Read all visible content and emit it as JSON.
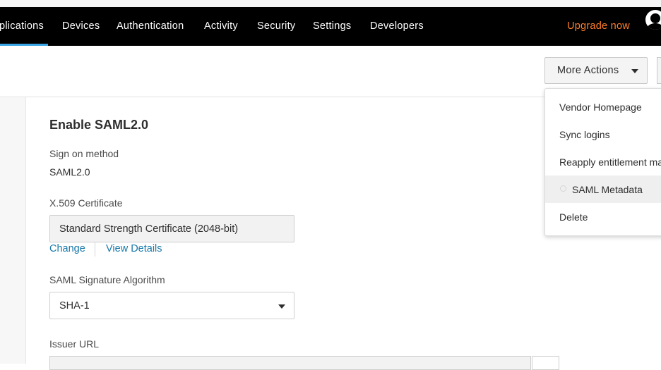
{
  "nav": {
    "items": [
      "plications",
      "Devices",
      "Authentication",
      "Activity",
      "Security",
      "Settings",
      "Developers"
    ],
    "upgrade": "Upgrade now",
    "active_color": "#3aa5e6",
    "upgrade_color": "#ff7e29"
  },
  "toolbar": {
    "more_actions": "More Actions"
  },
  "menu": {
    "items": [
      "Vendor Homepage",
      "Sync logins",
      "Reapply entitlement ma",
      "SAML Metadata",
      "Delete"
    ],
    "hovered": "SAML Metadata"
  },
  "form": {
    "title": "Enable SAML2.0",
    "sign_on": {
      "label": "Sign on method",
      "value": "SAML2.0"
    },
    "certificate": {
      "label": "X.509 Certificate",
      "value": "Standard Strength Certificate (2048-bit)",
      "change_link": "Change",
      "details_link": "View Details"
    },
    "signature": {
      "label": "SAML Signature Algorithm",
      "value": "SHA-1"
    },
    "issuer": {
      "label": "Issuer URL"
    }
  },
  "colors": {
    "link": "#1878a8",
    "navbar": "#000000"
  }
}
